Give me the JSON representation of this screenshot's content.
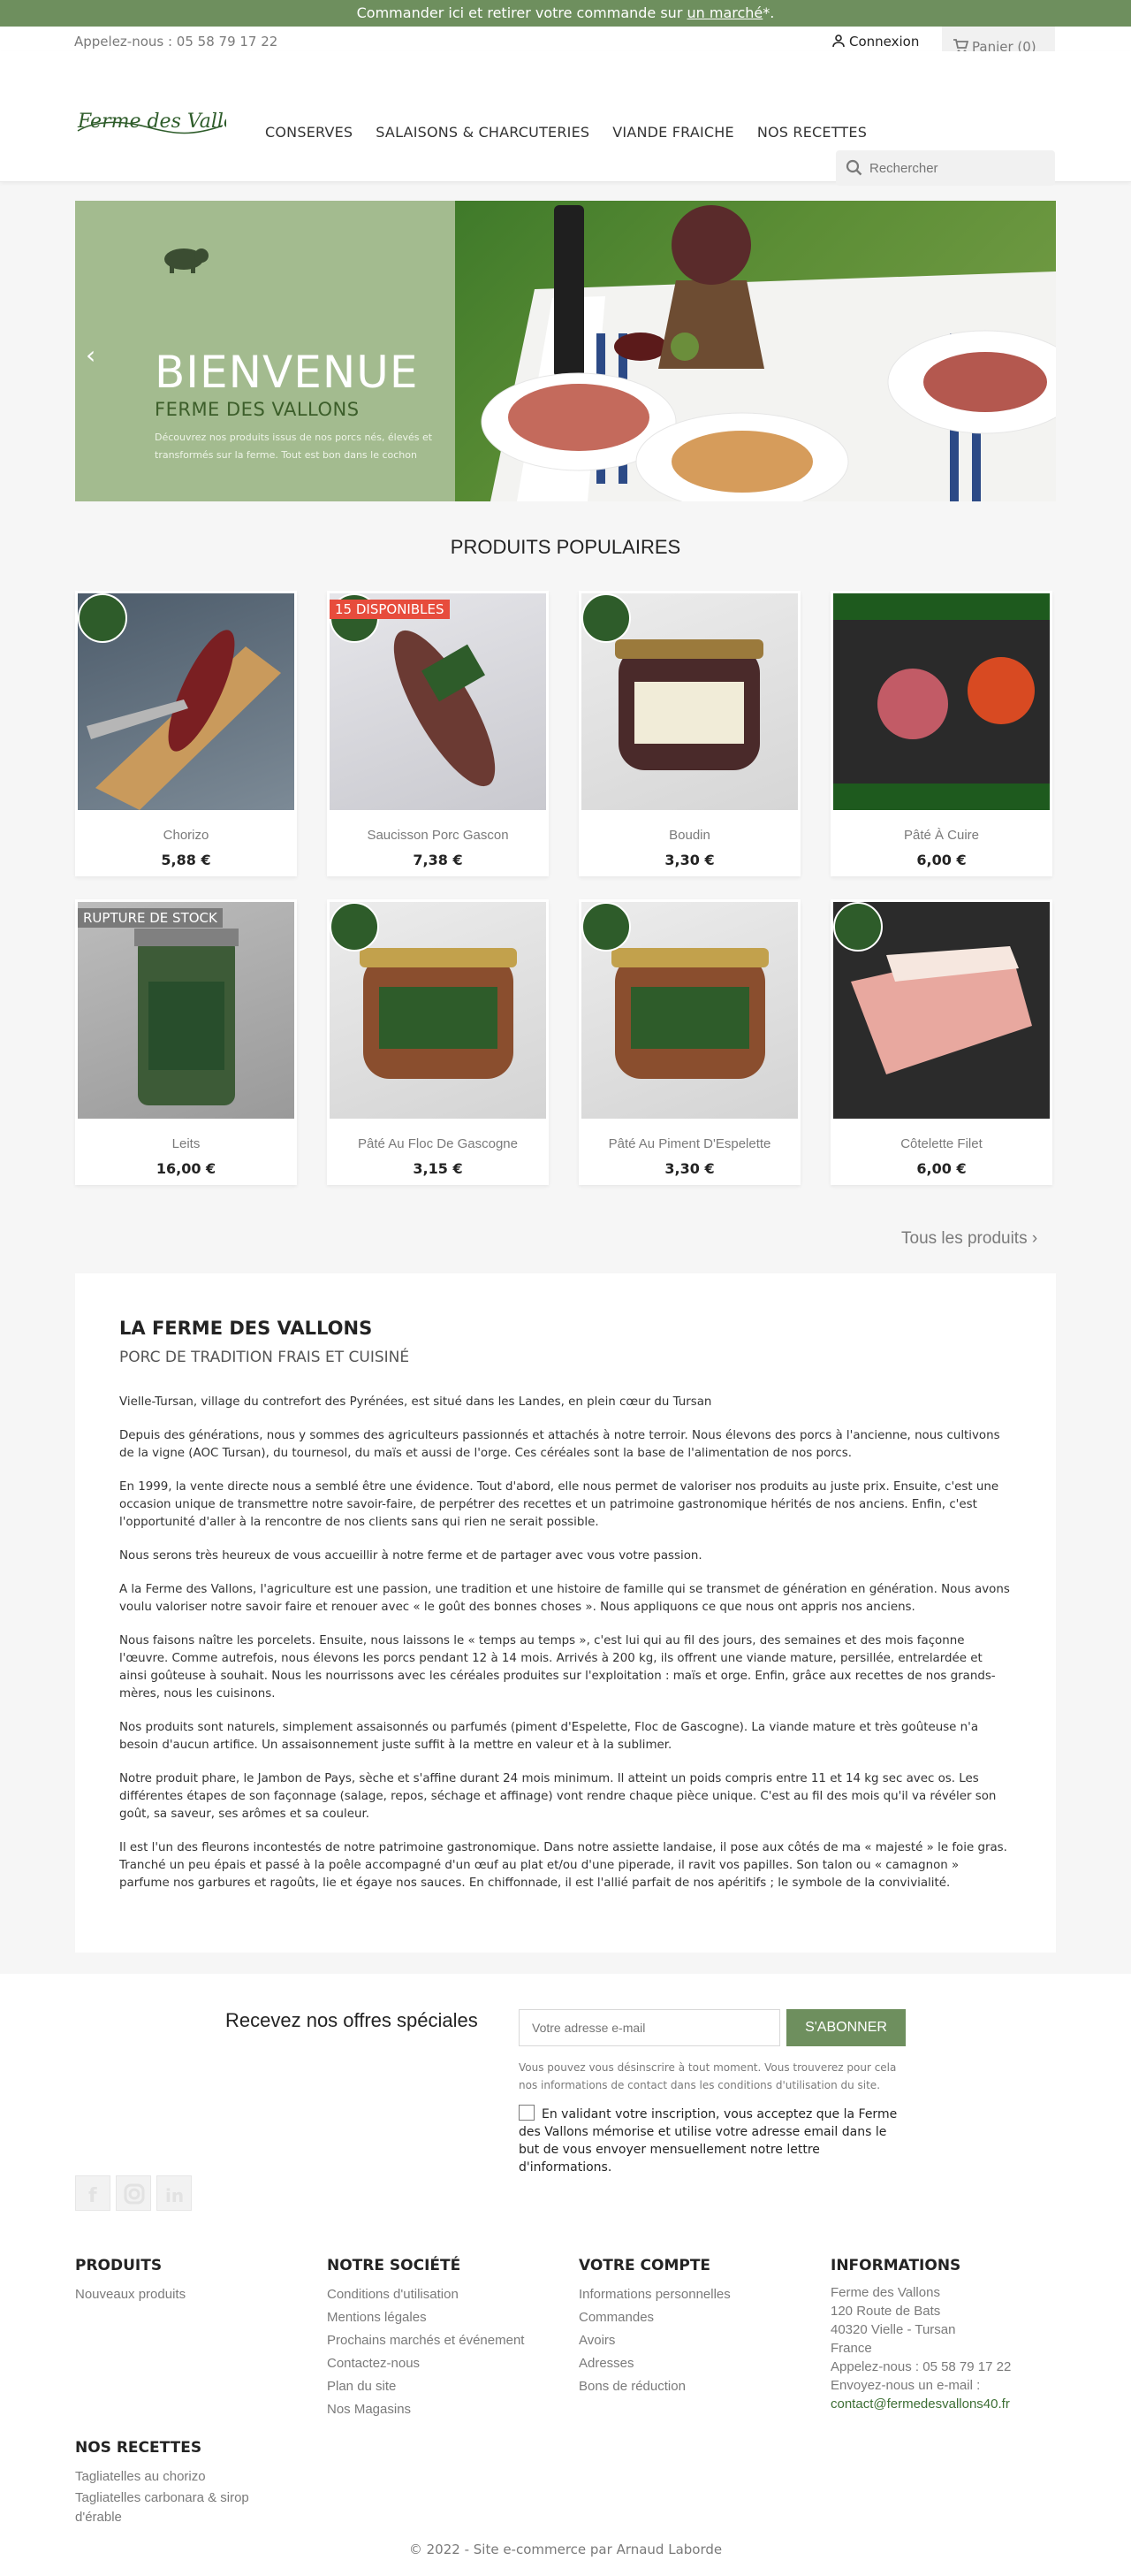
{
  "banner": {
    "prefix": "Commander ici et retirer votre commande sur",
    "link": "un marché",
    "suffix": "*."
  },
  "header": {
    "phone": "Appelez-nous : 05 58 79 17 22",
    "login": "Connexion",
    "cart": "Panier (0)",
    "logo_text": "Ferme des Vallons",
    "menu": [
      "CONSERVES",
      "SALAISONS & CHARCUTERIES",
      "VIANDE FRAICHE",
      "NOS RECETTES"
    ],
    "search_placeholder": "Rechercher"
  },
  "hero": {
    "title": "BIENVENUE",
    "subtitle": "FERME DES VALLONS",
    "text": "Découvrez nos produits issus de nos porcs nés, élevés et transformés sur la ferme. Tout est bon dans le cochon"
  },
  "section_title": "PRODUITS POPULAIRES",
  "products": [
    {
      "name": "Chorizo",
      "price": "5,88 €",
      "flag": ""
    },
    {
      "name": "Saucisson Porc Gascon",
      "price": "7,38 €",
      "flag": "15 DISPONIBLES"
    },
    {
      "name": "Boudin",
      "price": "3,30 €",
      "flag": ""
    },
    {
      "name": "Pâté À Cuire",
      "price": "6,00 €",
      "flag": ""
    },
    {
      "name": "Leits",
      "price": "16,00 €",
      "flag": "RUPTURE DE STOCK"
    },
    {
      "name": "Pâté Au Floc De Gascogne",
      "price": "3,15 €",
      "flag": ""
    },
    {
      "name": "Pâté Au Piment D'Espelette",
      "price": "3,30 €",
      "flag": ""
    },
    {
      "name": "Côtelette Filet",
      "price": "6,00 €",
      "flag": ""
    }
  ],
  "all_products": "Tous les produits ›",
  "about": {
    "title": "LA FERME DES VALLONS",
    "subtitle": "PORC DE TRADITION FRAIS ET CUISINÉ",
    "paragraphs": [
      "Vielle-Tursan, village du contrefort des Pyrénées, est situé dans les Landes, en plein cœur du Tursan",
      "Depuis des générations, nous y sommes des agriculteurs passionnés et attachés à notre terroir. Nous élevons des porcs à l'ancienne, nous cultivons de la vigne (AOC Tursan), du tournesol, du maïs et aussi de l'orge. Ces céréales sont la base de l'alimentation de nos porcs.",
      "En 1999, la vente directe nous a semblé être une évidence. Tout d'abord, elle nous permet de valoriser nos produits au juste prix. Ensuite, c'est une occasion unique de transmettre notre savoir-faire, de perpétrer des recettes et un patrimoine gastronomique hérités de nos anciens. Enfin, c'est l'opportunité d'aller à la rencontre de nos clients sans qui rien ne serait possible.",
      "Nous serons très heureux de vous accueillir à notre ferme et de partager avec vous votre passion.",
      "A la Ferme des Vallons, l'agriculture est une passion, une tradition et une histoire de famille qui se transmet de génération en génération. Nous avons voulu valoriser notre savoir faire et renouer avec « le goût des bonnes choses ». Nous appliquons ce que nous ont appris nos anciens.",
      "Nous faisons naître les porcelets. Ensuite, nous laissons le « temps au temps », c'est lui qui au fil des jours, des semaines et des mois façonne l'œuvre. Comme autrefois, nous élevons les porcs pendant 12 à 14 mois. Arrivés à 200 kg, ils offrent une viande mature, persillée, entrelardée et ainsi goûteuse à souhait. Nous les nourrissons avec les céréales produites sur l'exploitation : maïs et orge. Enfin, grâce aux recettes de nos grands-mères, nous les cuisinons.",
      "Nos produits sont naturels, simplement assaisonnés ou parfumés (piment d'Espelette, Floc de Gascogne). La viande mature et très goûteuse n'a besoin d'aucun artifice. Un assaisonnement juste suffit à la mettre en valeur et à la sublimer.",
      "Notre produit phare, le Jambon de Pays, sèche et s'affine durant 24 mois minimum. Il atteint un poids compris entre 11 et 14 kg sec avec os. Les différentes étapes de son façonnage (salage, repos, séchage et affinage) vont rendre chaque pièce unique. C'est au fil des mois qu'il va révéler son goût, sa saveur, ses arômes et sa couleur.",
      "Il est l'un des fleurons incontestés de notre patrimoine gastronomique. Dans notre assiette landaise, il pose aux côtés de ma « majesté » le foie gras. Tranché un peu épais et passé à la poêle accompagné d'un œuf au plat et/ou d'une piperade, il ravit vos papilles. Son talon ou « camagnon » parfume nos garbures et ragoûts, lie et égaye nos sauces. En chiffonnade, il est l'allié parfait de nos apéritifs ; le symbole de la convivialité."
    ]
  },
  "newsletter": {
    "title": "Recevez nos offres spéciales",
    "placeholder": "Votre adresse e-mail",
    "button": "S'ABONNER",
    "note": "Vous pouvez vous désinscrire à tout moment. Vous trouverez pour cela nos informations de contact dans les conditions d'utilisation du site.",
    "consent": "En validant votre inscription, vous acceptez que la Ferme des Vallons mémorise et utilise votre adresse email dans le but de vous envoyer mensuellement notre lettre d'informations."
  },
  "footer": {
    "produits": {
      "title": "PRODUITS",
      "links": [
        "Nouveaux produits"
      ]
    },
    "societe": {
      "title": "NOTRE SOCIÉTÉ",
      "links": [
        "Conditions d'utilisation",
        "Mentions légales",
        "Prochains marchés et événement",
        "Contactez-nous",
        "Plan du site",
        "Nos Magasins"
      ]
    },
    "compte": {
      "title": "VOTRE COMPTE",
      "links": [
        "Informations personnelles",
        "Commandes",
        "Avoirs",
        "Adresses",
        "Bons de réduction"
      ]
    },
    "infos": {
      "title": "INFORMATIONS",
      "lines": [
        "Ferme des Vallons",
        "120 Route de Bats",
        "40320 Vielle - Tursan",
        "France",
        "Appelez-nous : 05 58 79 17 22",
        "Envoyez-nous un e-mail :"
      ],
      "email": "contact@fermedesvallons40.fr"
    },
    "recettes": {
      "title": "NOS RECETTES",
      "links": [
        "Tagliatelles au chorizo",
        "Tagliatelles carbonara & sirop d'érable"
      ]
    },
    "copyright": "© 2022 - Site e-commerce par Arnaud Laborde"
  },
  "colors": {
    "brand_green": "#6e8f5e",
    "hero_green": "#a3bb8f",
    "flag_red": "#e74c3c",
    "flag_gray": "#7a7a7a"
  }
}
